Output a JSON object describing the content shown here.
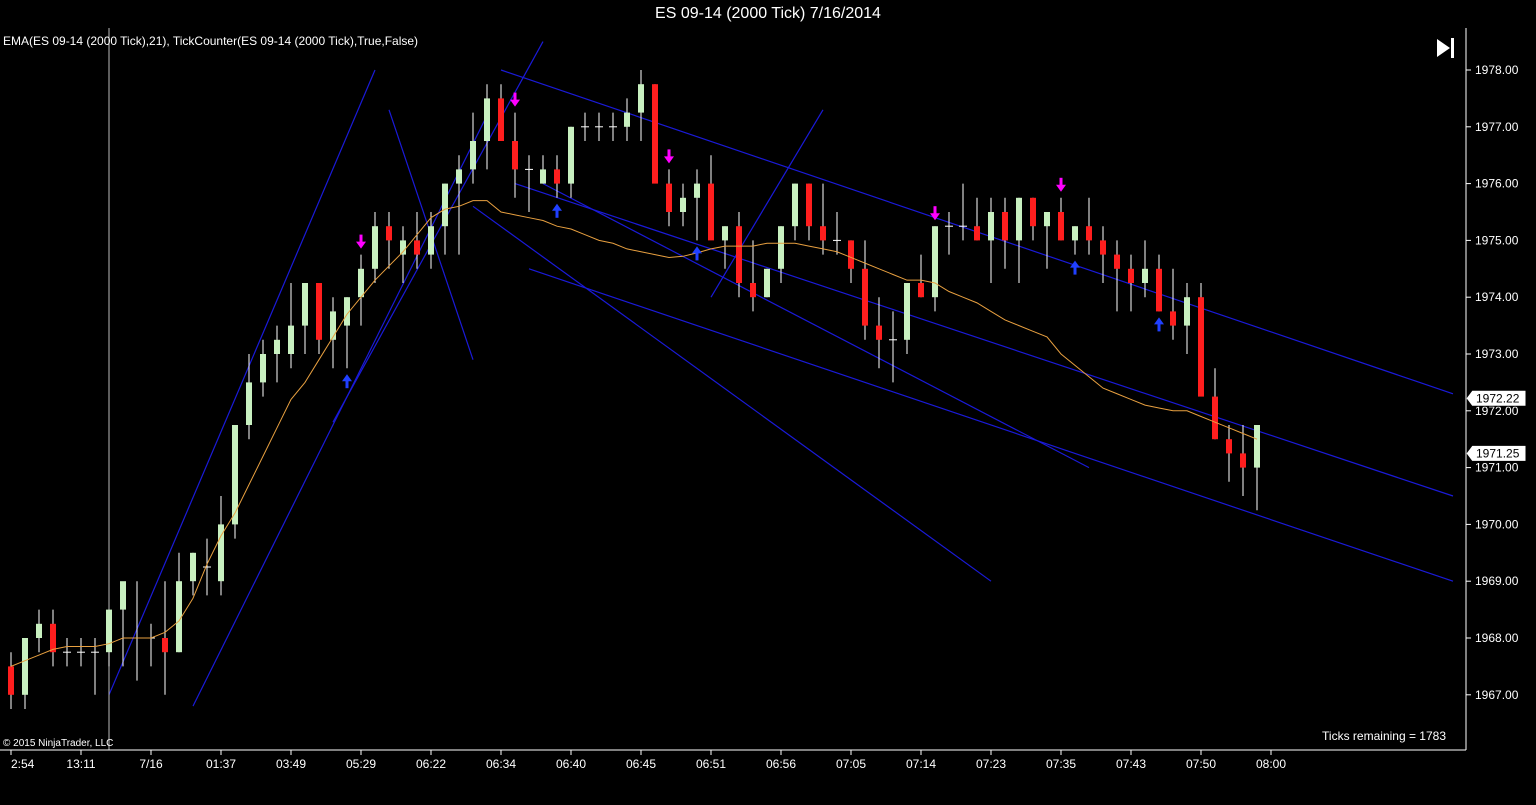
{
  "window": {
    "title": "ES 09-14 (2000 Tick)  7/16/2014"
  },
  "indicator_label": "EMA(ES 09-14 (2000 Tick),21),  TickCounter(ES 09-14 (2000 Tick),True,False)",
  "copyright": "© 2015 NinjaTrader, LLC",
  "ticks_remaining": "Ticks remaining = 1783",
  "colors": {
    "background": "#000000",
    "up_candle": "#c8f0c0",
    "down_candle": "#ff1e1e",
    "ema": "#e8a040",
    "trendline": "#1a1ad8",
    "arrow_down": "#ff00ff",
    "arrow_up": "#2040ff",
    "axis_text": "#ffffff"
  },
  "chart_data": {
    "type": "candlestick",
    "instrument": "ES 09-14",
    "interval": "2000 Tick",
    "date": "7/16/2014",
    "ylim": [
      1966.0,
      1978.5
    ],
    "y_ticks": [
      "1967.00",
      "1968.00",
      "1969.00",
      "1970.00",
      "1971.00",
      "1972.00",
      "1973.00",
      "1974.00",
      "1975.00",
      "1976.00",
      "1977.00",
      "1978.00"
    ],
    "x_labels": [
      {
        "bar": 0,
        "label": "2:54"
      },
      {
        "bar": 5,
        "label": "13:11"
      },
      {
        "bar": 10,
        "label": "7/16"
      },
      {
        "bar": 15,
        "label": "01:37"
      },
      {
        "bar": 20,
        "label": "03:49"
      },
      {
        "bar": 25,
        "label": "05:29"
      },
      {
        "bar": 30,
        "label": "06:22"
      },
      {
        "bar": 35,
        "label": "06:34"
      },
      {
        "bar": 40,
        "label": "06:40"
      },
      {
        "bar": 45,
        "label": "06:45"
      },
      {
        "bar": 50,
        "label": "06:51"
      },
      {
        "bar": 55,
        "label": "06:56"
      },
      {
        "bar": 60,
        "label": "07:05"
      },
      {
        "bar": 65,
        "label": "07:14"
      },
      {
        "bar": 70,
        "label": "07:23"
      },
      {
        "bar": 75,
        "label": "07:35"
      },
      {
        "bar": 80,
        "label": "07:43"
      },
      {
        "bar": 85,
        "label": "07:50"
      },
      {
        "bar": 90,
        "label": "08:00"
      }
    ],
    "price_flags": [
      "1972.22",
      "1971.25"
    ],
    "price_flag_values": [
      1972.22,
      1971.25
    ],
    "candles": [
      [
        1967.5,
        1967.75,
        1966.75,
        1967.0
      ],
      [
        1967.0,
        1968.0,
        1966.75,
        1968.0
      ],
      [
        1968.0,
        1968.5,
        1967.75,
        1968.25
      ],
      [
        1968.25,
        1968.5,
        1967.5,
        1967.75
      ],
      [
        1967.75,
        1968.0,
        1967.5,
        1967.75
      ],
      [
        1967.75,
        1968.0,
        1967.5,
        1967.75
      ],
      [
        1967.75,
        1968.0,
        1967.0,
        1967.75
      ],
      [
        1967.75,
        1968.5,
        1967.5,
        1968.5
      ],
      [
        1968.5,
        1968.75,
        1967.5,
        1969.0
      ],
      [
        1968.0,
        1969.0,
        1967.25,
        1968.0
      ],
      [
        1968.0,
        1968.25,
        1967.5,
        1968.0
      ],
      [
        1968.0,
        1969.0,
        1967.0,
        1967.75
      ],
      [
        1967.75,
        1969.5,
        1967.75,
        1969.0
      ],
      [
        1969.0,
        1969.5,
        1968.75,
        1969.5
      ],
      [
        1969.25,
        1969.75,
        1968.75,
        1969.25
      ],
      [
        1969.0,
        1970.5,
        1968.75,
        1970.0
      ],
      [
        1970.0,
        1971.75,
        1969.75,
        1971.75
      ],
      [
        1971.75,
        1973.0,
        1971.5,
        1972.5
      ],
      [
        1972.5,
        1973.25,
        1972.25,
        1973.0
      ],
      [
        1973.0,
        1973.5,
        1972.5,
        1973.25
      ],
      [
        1973.0,
        1974.25,
        1972.75,
        1973.5
      ],
      [
        1973.5,
        1974.25,
        1973.0,
        1974.25
      ],
      [
        1974.25,
        1974.25,
        1973.0,
        1973.25
      ],
      [
        1973.25,
        1974.0,
        1972.75,
        1973.75
      ],
      [
        1973.5,
        1974.0,
        1972.75,
        1974.0
      ],
      [
        1974.0,
        1974.75,
        1973.5,
        1974.5
      ],
      [
        1974.5,
        1975.5,
        1974.25,
        1975.25
      ],
      [
        1975.25,
        1975.5,
        1974.5,
        1975.0
      ],
      [
        1974.75,
        1975.25,
        1974.25,
        1975.0
      ],
      [
        1975.0,
        1975.5,
        1974.5,
        1974.75
      ],
      [
        1974.75,
        1975.5,
        1974.5,
        1975.25
      ],
      [
        1975.25,
        1976.0,
        1974.75,
        1976.0
      ],
      [
        1976.0,
        1976.5,
        1974.75,
        1976.25
      ],
      [
        1976.25,
        1977.25,
        1976.0,
        1976.75
      ],
      [
        1976.75,
        1977.75,
        1976.25,
        1977.5
      ],
      [
        1977.5,
        1977.75,
        1976.75,
        1976.75
      ],
      [
        1976.75,
        1977.25,
        1975.75,
        1976.25
      ],
      [
        1976.25,
        1976.5,
        1975.5,
        1976.25
      ],
      [
        1976.0,
        1976.5,
        1976.0,
        1976.25
      ],
      [
        1976.25,
        1976.5,
        1975.75,
        1976.0
      ],
      [
        1976.0,
        1977.0,
        1975.75,
        1977.0
      ],
      [
        1977.0,
        1977.25,
        1976.75,
        1977.0
      ],
      [
        1977.0,
        1977.25,
        1976.75,
        1977.0
      ],
      [
        1977.0,
        1977.25,
        1976.75,
        1977.0
      ],
      [
        1977.0,
        1977.5,
        1976.75,
        1977.25
      ],
      [
        1977.25,
        1978.0,
        1976.75,
        1977.75
      ],
      [
        1977.75,
        1977.75,
        1976.5,
        1976.0
      ],
      [
        1976.0,
        1976.25,
        1975.25,
        1975.5
      ],
      [
        1975.5,
        1976.0,
        1975.25,
        1975.75
      ],
      [
        1975.75,
        1976.25,
        1975.0,
        1976.0
      ],
      [
        1976.0,
        1976.5,
        1975.25,
        1975.0
      ],
      [
        1975.0,
        1975.25,
        1974.5,
        1975.25
      ],
      [
        1975.25,
        1975.5,
        1974.0,
        1974.25
      ],
      [
        1974.25,
        1975.0,
        1973.75,
        1974.0
      ],
      [
        1974.0,
        1974.5,
        1974.0,
        1974.5
      ],
      [
        1974.5,
        1975.25,
        1974.25,
        1975.25
      ],
      [
        1975.25,
        1976.0,
        1975.0,
        1976.0
      ],
      [
        1976.0,
        1976.0,
        1975.0,
        1975.25
      ],
      [
        1975.25,
        1976.0,
        1974.75,
        1975.0
      ],
      [
        1975.0,
        1975.5,
        1974.75,
        1975.0
      ],
      [
        1975.0,
        1975.0,
        1974.25,
        1974.5
      ],
      [
        1974.5,
        1975.0,
        1973.25,
        1973.5
      ],
      [
        1973.5,
        1974.0,
        1972.75,
        1973.25
      ],
      [
        1973.25,
        1973.75,
        1972.5,
        1973.25
      ],
      [
        1973.25,
        1974.25,
        1973.0,
        1974.25
      ],
      [
        1974.25,
        1974.75,
        1974.0,
        1974.0
      ],
      [
        1974.0,
        1975.25,
        1973.75,
        1975.25
      ],
      [
        1975.25,
        1975.5,
        1974.75,
        1975.25
      ],
      [
        1975.25,
        1976.0,
        1975.0,
        1975.25
      ],
      [
        1975.25,
        1975.75,
        1975.0,
        1975.0
      ],
      [
        1975.0,
        1975.75,
        1974.25,
        1975.5
      ],
      [
        1975.5,
        1975.75,
        1974.5,
        1975.0
      ],
      [
        1975.0,
        1975.75,
        1974.25,
        1975.75
      ],
      [
        1975.75,
        1975.75,
        1975.0,
        1975.25
      ],
      [
        1975.25,
        1975.5,
        1974.5,
        1975.5
      ],
      [
        1975.5,
        1975.75,
        1975.0,
        1975.0
      ],
      [
        1975.0,
        1975.25,
        1974.75,
        1975.25
      ],
      [
        1975.25,
        1975.75,
        1974.75,
        1975.0
      ],
      [
        1975.0,
        1975.25,
        1974.25,
        1974.75
      ],
      [
        1974.75,
        1975.0,
        1973.75,
        1974.5
      ],
      [
        1974.5,
        1974.75,
        1973.75,
        1974.25
      ],
      [
        1974.25,
        1975.0,
        1974.0,
        1974.5
      ],
      [
        1974.5,
        1974.75,
        1973.75,
        1973.75
      ],
      [
        1973.75,
        1974.5,
        1973.25,
        1973.5
      ],
      [
        1973.5,
        1974.25,
        1973.0,
        1974.0
      ],
      [
        1974.0,
        1974.25,
        1972.75,
        1972.25
      ],
      [
        1972.25,
        1972.75,
        1971.5,
        1971.5
      ],
      [
        1971.5,
        1971.75,
        1970.75,
        1971.25
      ],
      [
        1971.25,
        1971.75,
        1970.5,
        1971.0
      ],
      [
        1971.0,
        1971.75,
        1970.25,
        1971.75
      ]
    ],
    "ema": [
      1967.5,
      1967.6,
      1967.7,
      1967.8,
      1967.85,
      1967.85,
      1967.85,
      1967.9,
      1968.0,
      1968.0,
      1968.0,
      1968.1,
      1968.3,
      1968.7,
      1969.3,
      1969.8,
      1970.2,
      1970.7,
      1971.2,
      1971.7,
      1972.2,
      1972.5,
      1972.9,
      1973.3,
      1973.7,
      1974.0,
      1974.3,
      1974.55,
      1974.8,
      1975.1,
      1975.4,
      1975.55,
      1975.6,
      1975.7,
      1975.7,
      1975.5,
      1975.45,
      1975.4,
      1975.35,
      1975.25,
      1975.2,
      1975.1,
      1975.0,
      1974.95,
      1974.85,
      1974.8,
      1974.75,
      1974.7,
      1974.72,
      1974.78,
      1974.85,
      1974.9,
      1974.9,
      1974.9,
      1974.95,
      1974.95,
      1974.95,
      1974.9,
      1974.85,
      1974.8,
      1974.7,
      1974.6,
      1974.5,
      1974.4,
      1974.3,
      1974.3,
      1974.25,
      1974.1,
      1974.0,
      1973.9,
      1973.75,
      1973.6,
      1973.5,
      1973.4,
      1973.3,
      1973.0,
      1972.8,
      1972.6,
      1972.4,
      1972.3,
      1972.2,
      1972.1,
      1972.05,
      1972.0,
      1972.0,
      1971.9,
      1971.8,
      1971.7,
      1971.6,
      1971.5
    ],
    "down_arrows": [
      25,
      36,
      47,
      66,
      75
    ],
    "up_arrows": [
      24,
      39,
      49,
      76,
      82
    ],
    "trendlines": [
      {
        "from": [
          7,
          1967.0
        ],
        "to": [
          26,
          1978.0
        ]
      },
      {
        "from": [
          13,
          1966.8
        ],
        "to": [
          34,
          1977.2
        ]
      },
      {
        "from": [
          23,
          1971.8
        ],
        "to": [
          38,
          1978.5
        ]
      },
      {
        "from": [
          27,
          1977.3
        ],
        "to": [
          33,
          1972.9
        ]
      },
      {
        "from": [
          35,
          1978.0
        ],
        "to": [
          103,
          1972.3
        ]
      },
      {
        "from": [
          33,
          1975.6
        ],
        "to": [
          70,
          1969.0
        ]
      },
      {
        "from": [
          38,
          1976.0
        ],
        "to": [
          77,
          1971.0
        ]
      },
      {
        "from": [
          50,
          1974.0
        ],
        "to": [
          58,
          1977.3
        ]
      },
      {
        "from": [
          37,
          1974.5
        ],
        "to": [
          103,
          1969.0
        ]
      },
      {
        "from": [
          36,
          1976.0
        ],
        "to": [
          103,
          1970.5
        ]
      }
    ]
  }
}
